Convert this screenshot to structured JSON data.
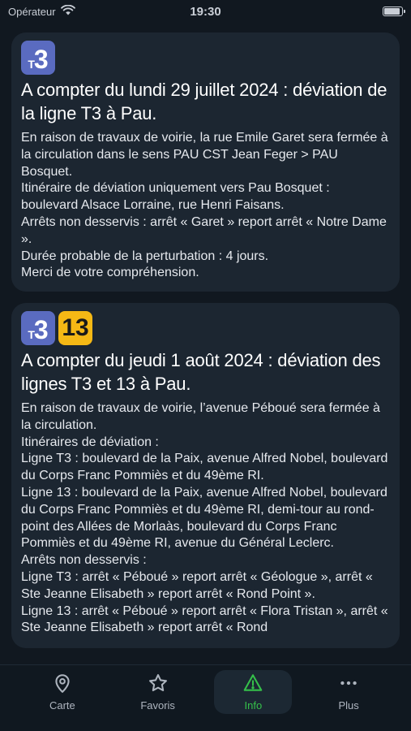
{
  "status_bar": {
    "carrier": "Opérateur",
    "time": "19:30"
  },
  "alerts": [
    {
      "lines": [
        {
          "prefix": "T",
          "number": "3",
          "color": "#5a6bc0"
        }
      ],
      "title": "A compter du lundi 29 juillet 2024 : déviation de la ligne T3 à Pau.",
      "body": [
        "En raison de travaux de voirie, la rue Emile Garet sera fermée à la circulation dans le sens PAU CST Jean Feger > PAU Bosquet.",
        "Itinéraire de déviation uniquement vers Pau Bosquet : boulevard Alsace Lorraine, rue Henri Faisans.",
        "Arrêts non desservis : arrêt « Garet » report arrêt « Notre Dame ».",
        "Durée probable de la perturbation : 4 jours.",
        "Merci de votre compréhension."
      ]
    },
    {
      "lines": [
        {
          "prefix": "T",
          "number": "3",
          "color": "#5a6bc0"
        },
        {
          "prefix": "",
          "number": "13",
          "color": "#f5b815"
        }
      ],
      "title": "A compter du jeudi 1 août 2024 : déviation des lignes T3 et 13 à Pau.",
      "body": [
        "En raison de travaux de voirie, l’avenue Péboué sera fermée à la circulation.",
        "Itinéraires de déviation :",
        "Ligne T3 : boulevard de la Paix, avenue Alfred Nobel, boulevard du Corps Franc Pommiès et du 49ème RI.",
        "Ligne 13 : boulevard de la Paix, avenue Alfred Nobel, boulevard du Corps Franc Pommiès et du 49ème RI, demi-tour au rond-point des Allées de Morlaàs, boulevard du Corps Franc Pommiès et du 49ème RI, avenue du Général Leclerc.",
        "Arrêts non desservis :",
        "Ligne T3 : arrêt « Péboué » report arrêt « Géologue », arrêt « Ste Jeanne Elisabeth » report arrêt « Rond Point ».",
        "Ligne 13 : arrêt « Péboué » report arrêt « Flora Tristan », arrêt « Ste Jeanne Elisabeth » report arrêt « Rond"
      ]
    }
  ],
  "tab_bar": {
    "tabs": [
      {
        "label": "Carte",
        "icon": "map-pin-icon",
        "active": false
      },
      {
        "label": "Favoris",
        "icon": "star-icon",
        "active": false
      },
      {
        "label": "Info",
        "icon": "warning-icon",
        "active": true
      },
      {
        "label": "Plus",
        "icon": "more-icon",
        "active": false
      }
    ],
    "active_color": "#35c04a"
  }
}
